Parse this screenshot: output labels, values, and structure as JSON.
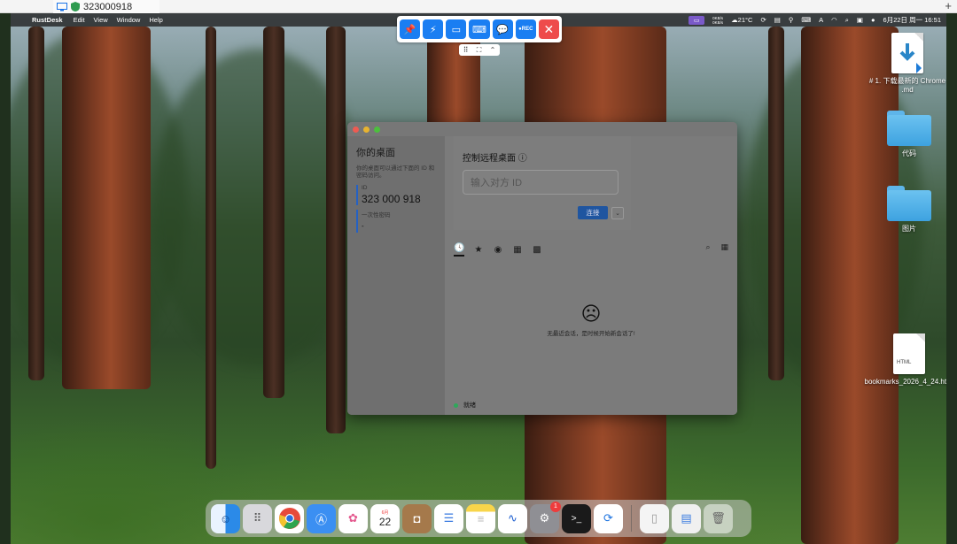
{
  "viewer": {
    "tab_title": "323000918",
    "add_tab": "+"
  },
  "menubar": {
    "app": "RustDesk",
    "items": [
      "Edit",
      "View",
      "Window",
      "Help"
    ],
    "netspeed_up": "0KB/s",
    "netspeed_down": "0KB/s",
    "weather": "21°C",
    "input_indicator": "A",
    "datetime": "6月22日 周一 16:51"
  },
  "remote_toolbar": {
    "rec_label": "●REC"
  },
  "desktop_icons": [
    {
      "label": "# 1. 下载最新的 Chrome .md",
      "kind": "doc"
    },
    {
      "label": "代码",
      "kind": "folder"
    },
    {
      "label": "图片",
      "kind": "folder"
    },
    {
      "label": "bookmarks_2026_4_24.html",
      "kind": "doc",
      "badge": "HTML"
    }
  ],
  "rustdesk": {
    "left": {
      "title": "你的桌面",
      "desc": "你的桌面可以通过下面的 ID 和密码访问。",
      "id_label": "ID",
      "id_value": "323 000 918",
      "pw_label": "一次性密码",
      "pw_value": "-"
    },
    "connect": {
      "title": "控制远程桌面",
      "placeholder": "输入对方 ID",
      "button": "连接"
    },
    "empty_message": "无最近会话，是时候开始新会话了!",
    "status": "就绪"
  },
  "dock": {
    "calendar_month": "6月",
    "calendar_day": "22",
    "settings_badge": "1"
  }
}
